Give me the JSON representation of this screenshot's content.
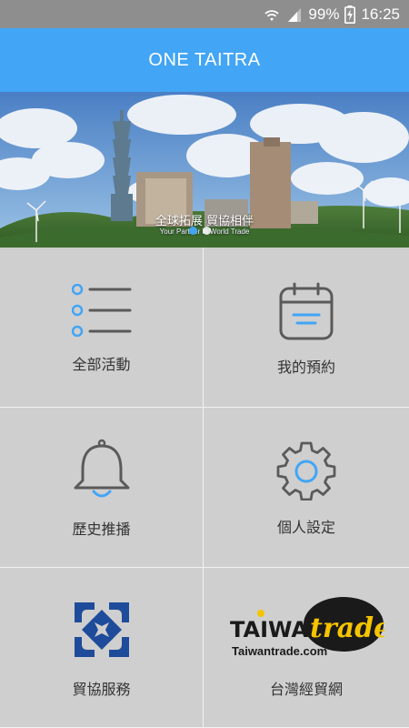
{
  "status_bar": {
    "battery": "99%",
    "time": "16:25"
  },
  "app_bar": {
    "title": "ONE TAITRA"
  },
  "banner": {
    "caption_main": "全球拓展 貿協相伴",
    "caption_sub": "Your Partner in World Trade",
    "slides": 2,
    "active_slide": 1
  },
  "menu": [
    {
      "label": "全部活動",
      "icon": "list-icon"
    },
    {
      "label": "我的預約",
      "icon": "calendar-icon"
    },
    {
      "label": "歷史推播",
      "icon": "bell-icon"
    },
    {
      "label": "個人設定",
      "icon": "gear-icon"
    },
    {
      "label": "貿協服務",
      "icon": "taitra-logo-icon"
    },
    {
      "label": "台灣經貿網",
      "icon": "taiwantrade-logo-icon"
    }
  ],
  "taiwantrade_logo": {
    "word_taiwan": "TAIWAN",
    "word_trade": "trade",
    "site": "Taiwantrade.com"
  },
  "colors": {
    "accent": "#42a5f5",
    "icon_gray": "#5a5a5a",
    "taitra_blue": "#1f4c9a"
  }
}
